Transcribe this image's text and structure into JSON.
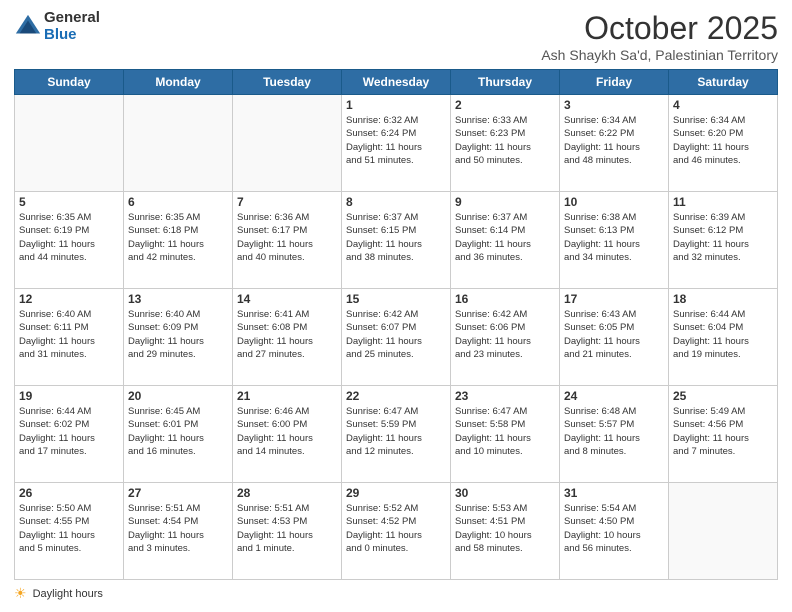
{
  "header": {
    "logo_general": "General",
    "logo_blue": "Blue",
    "month_title": "October 2025",
    "subtitle": "Ash Shaykh Sa'd, Palestinian Territory"
  },
  "days_of_week": [
    "Sunday",
    "Monday",
    "Tuesday",
    "Wednesday",
    "Thursday",
    "Friday",
    "Saturday"
  ],
  "weeks": [
    [
      {
        "day": "",
        "info": ""
      },
      {
        "day": "",
        "info": ""
      },
      {
        "day": "",
        "info": ""
      },
      {
        "day": "1",
        "info": "Sunrise: 6:32 AM\nSunset: 6:24 PM\nDaylight: 11 hours\nand 51 minutes."
      },
      {
        "day": "2",
        "info": "Sunrise: 6:33 AM\nSunset: 6:23 PM\nDaylight: 11 hours\nand 50 minutes."
      },
      {
        "day": "3",
        "info": "Sunrise: 6:34 AM\nSunset: 6:22 PM\nDaylight: 11 hours\nand 48 minutes."
      },
      {
        "day": "4",
        "info": "Sunrise: 6:34 AM\nSunset: 6:20 PM\nDaylight: 11 hours\nand 46 minutes."
      }
    ],
    [
      {
        "day": "5",
        "info": "Sunrise: 6:35 AM\nSunset: 6:19 PM\nDaylight: 11 hours\nand 44 minutes."
      },
      {
        "day": "6",
        "info": "Sunrise: 6:35 AM\nSunset: 6:18 PM\nDaylight: 11 hours\nand 42 minutes."
      },
      {
        "day": "7",
        "info": "Sunrise: 6:36 AM\nSunset: 6:17 PM\nDaylight: 11 hours\nand 40 minutes."
      },
      {
        "day": "8",
        "info": "Sunrise: 6:37 AM\nSunset: 6:15 PM\nDaylight: 11 hours\nand 38 minutes."
      },
      {
        "day": "9",
        "info": "Sunrise: 6:37 AM\nSunset: 6:14 PM\nDaylight: 11 hours\nand 36 minutes."
      },
      {
        "day": "10",
        "info": "Sunrise: 6:38 AM\nSunset: 6:13 PM\nDaylight: 11 hours\nand 34 minutes."
      },
      {
        "day": "11",
        "info": "Sunrise: 6:39 AM\nSunset: 6:12 PM\nDaylight: 11 hours\nand 32 minutes."
      }
    ],
    [
      {
        "day": "12",
        "info": "Sunrise: 6:40 AM\nSunset: 6:11 PM\nDaylight: 11 hours\nand 31 minutes."
      },
      {
        "day": "13",
        "info": "Sunrise: 6:40 AM\nSunset: 6:09 PM\nDaylight: 11 hours\nand 29 minutes."
      },
      {
        "day": "14",
        "info": "Sunrise: 6:41 AM\nSunset: 6:08 PM\nDaylight: 11 hours\nand 27 minutes."
      },
      {
        "day": "15",
        "info": "Sunrise: 6:42 AM\nSunset: 6:07 PM\nDaylight: 11 hours\nand 25 minutes."
      },
      {
        "day": "16",
        "info": "Sunrise: 6:42 AM\nSunset: 6:06 PM\nDaylight: 11 hours\nand 23 minutes."
      },
      {
        "day": "17",
        "info": "Sunrise: 6:43 AM\nSunset: 6:05 PM\nDaylight: 11 hours\nand 21 minutes."
      },
      {
        "day": "18",
        "info": "Sunrise: 6:44 AM\nSunset: 6:04 PM\nDaylight: 11 hours\nand 19 minutes."
      }
    ],
    [
      {
        "day": "19",
        "info": "Sunrise: 6:44 AM\nSunset: 6:02 PM\nDaylight: 11 hours\nand 17 minutes."
      },
      {
        "day": "20",
        "info": "Sunrise: 6:45 AM\nSunset: 6:01 PM\nDaylight: 11 hours\nand 16 minutes."
      },
      {
        "day": "21",
        "info": "Sunrise: 6:46 AM\nSunset: 6:00 PM\nDaylight: 11 hours\nand 14 minutes."
      },
      {
        "day": "22",
        "info": "Sunrise: 6:47 AM\nSunset: 5:59 PM\nDaylight: 11 hours\nand 12 minutes."
      },
      {
        "day": "23",
        "info": "Sunrise: 6:47 AM\nSunset: 5:58 PM\nDaylight: 11 hours\nand 10 minutes."
      },
      {
        "day": "24",
        "info": "Sunrise: 6:48 AM\nSunset: 5:57 PM\nDaylight: 11 hours\nand 8 minutes."
      },
      {
        "day": "25",
        "info": "Sunrise: 5:49 AM\nSunset: 4:56 PM\nDaylight: 11 hours\nand 7 minutes."
      }
    ],
    [
      {
        "day": "26",
        "info": "Sunrise: 5:50 AM\nSunset: 4:55 PM\nDaylight: 11 hours\nand 5 minutes."
      },
      {
        "day": "27",
        "info": "Sunrise: 5:51 AM\nSunset: 4:54 PM\nDaylight: 11 hours\nand 3 minutes."
      },
      {
        "day": "28",
        "info": "Sunrise: 5:51 AM\nSunset: 4:53 PM\nDaylight: 11 hours\nand 1 minute."
      },
      {
        "day": "29",
        "info": "Sunrise: 5:52 AM\nSunset: 4:52 PM\nDaylight: 11 hours\nand 0 minutes."
      },
      {
        "day": "30",
        "info": "Sunrise: 5:53 AM\nSunset: 4:51 PM\nDaylight: 10 hours\nand 58 minutes."
      },
      {
        "day": "31",
        "info": "Sunrise: 5:54 AM\nSunset: 4:50 PM\nDaylight: 10 hours\nand 56 minutes."
      },
      {
        "day": "",
        "info": ""
      }
    ]
  ],
  "footer": {
    "daylight_label": "Daylight hours"
  }
}
